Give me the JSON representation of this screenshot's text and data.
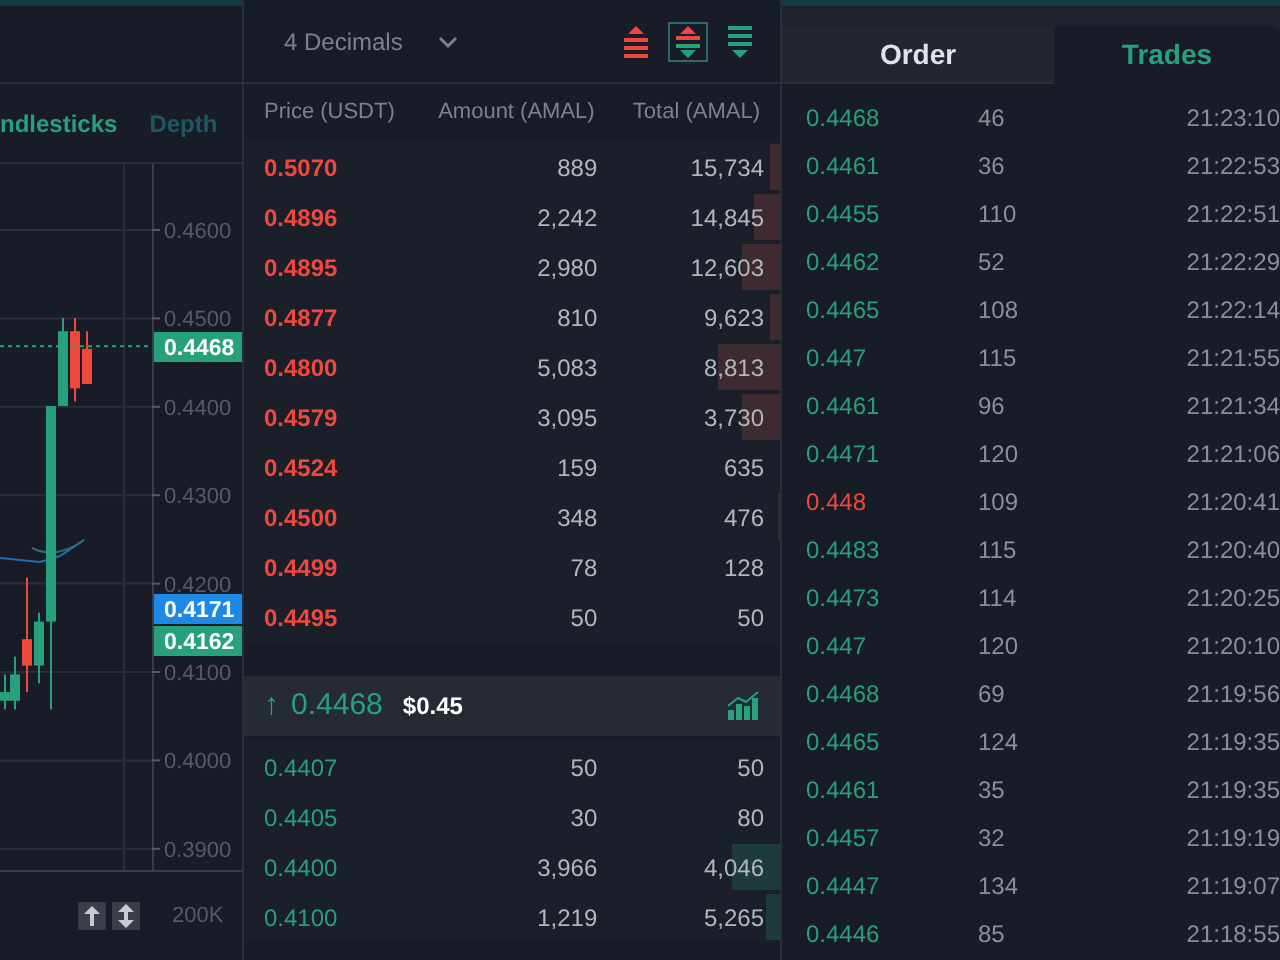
{
  "chart": {
    "tabs": [
      {
        "label": "ndlesticks",
        "selected": true
      },
      {
        "label": "Depth",
        "selected": false
      }
    ],
    "price_axis": [
      "0.4600",
      "0.4500",
      "0.4400",
      "0.4300",
      "0.4200",
      "0.4100",
      "0.4000",
      "0.3900"
    ],
    "price_tags": [
      {
        "label": "0.4468",
        "color": "#26a17b"
      },
      {
        "label": "0.4171",
        "color": "#1e88e5"
      },
      {
        "label": "0.4162",
        "color": "#26a17b"
      }
    ],
    "volume_axis": "200K"
  },
  "order_book": {
    "decimals": "4 Decimals",
    "views": [
      {
        "kind": "asks",
        "selected": false
      },
      {
        "kind": "both",
        "selected": true
      },
      {
        "kind": "bids",
        "selected": false
      }
    ],
    "columns": [
      "Price (USDT)",
      "Amount (AMAL)",
      "Total (AMAL)"
    ],
    "asks": [
      {
        "price": "0.5070",
        "amount": "889",
        "total": "15,734",
        "level": 0.02
      },
      {
        "price": "0.4896",
        "amount": "2,242",
        "total": "14,845",
        "level": 0.05
      },
      {
        "price": "0.4895",
        "amount": "2,980",
        "total": "12,603",
        "level": 0.07
      },
      {
        "price": "0.4877",
        "amount": "810",
        "total": "9,623",
        "level": 0.02
      },
      {
        "price": "0.4800",
        "amount": "5,083",
        "total": "8,813",
        "level": 0.115
      },
      {
        "price": "0.4579",
        "amount": "3,095",
        "total": "3,730",
        "level": 0.07
      },
      {
        "price": "0.4524",
        "amount": "159",
        "total": "635"
      },
      {
        "price": "0.4500",
        "amount": "348",
        "total": "476",
        "level": 0.005
      },
      {
        "price": "0.4499",
        "amount": "78",
        "total": "128"
      },
      {
        "price": "0.4495",
        "amount": "50",
        "total": "50"
      }
    ],
    "last": {
      "arrow": "↑",
      "price": "0.4468",
      "usd": "$0.45"
    },
    "bids": [
      {
        "price": "0.4407",
        "amount": "50",
        "total": "50"
      },
      {
        "price": "0.4405",
        "amount": "30",
        "total": "80"
      },
      {
        "price": "0.4400",
        "amount": "3,966",
        "total": "4,046",
        "level": 0.09
      },
      {
        "price": "0.4100",
        "amount": "1,219",
        "total": "5,265",
        "level": 0.025
      }
    ]
  },
  "trades_panel": {
    "tabs": [
      {
        "label": "Order",
        "selected": false
      },
      {
        "label": "Trades",
        "selected": true
      }
    ],
    "trades": [
      {
        "price": "0.4468",
        "amount": "46",
        "time": "21:23:10",
        "color": "#26a17b"
      },
      {
        "price": "0.4461",
        "amount": "36",
        "time": "21:22:53",
        "color": "#26a17b"
      },
      {
        "price": "0.4455",
        "amount": "110",
        "time": "21:22:51",
        "color": "#26a17b"
      },
      {
        "price": "0.4462",
        "amount": "52",
        "time": "21:22:29",
        "color": "#26a17b"
      },
      {
        "price": "0.4465",
        "amount": "108",
        "time": "21:22:14",
        "color": "#26a17b"
      },
      {
        "price": "0.447",
        "amount": "115",
        "time": "21:21:55",
        "color": "#26a17b"
      },
      {
        "price": "0.4461",
        "amount": "96",
        "time": "21:21:34",
        "color": "#26a17b"
      },
      {
        "price": "0.4471",
        "amount": "120",
        "time": "21:21:06",
        "color": "#26a17b"
      },
      {
        "price": "0.448",
        "amount": "109",
        "time": "21:20:41",
        "color": "#f0483e"
      },
      {
        "price": "0.4483",
        "amount": "115",
        "time": "21:20:40",
        "color": "#26a17b"
      },
      {
        "price": "0.4473",
        "amount": "114",
        "time": "21:20:25",
        "color": "#26a17b"
      },
      {
        "price": "0.447",
        "amount": "120",
        "time": "21:20:10",
        "color": "#26a17b"
      },
      {
        "price": "0.4468",
        "amount": "69",
        "time": "21:19:56",
        "color": "#26a17b"
      },
      {
        "price": "0.4465",
        "amount": "124",
        "time": "21:19:35",
        "color": "#26a17b"
      },
      {
        "price": "0.4461",
        "amount": "35",
        "time": "21:19:35",
        "color": "#26a17b"
      },
      {
        "price": "0.4457",
        "amount": "32",
        "time": "21:19:19",
        "color": "#26a17b"
      },
      {
        "price": "0.4447",
        "amount": "134",
        "time": "21:19:07",
        "color": "#26a17b"
      },
      {
        "price": "0.4446",
        "amount": "85",
        "time": "21:18:55",
        "color": "#26a17b"
      }
    ]
  }
}
